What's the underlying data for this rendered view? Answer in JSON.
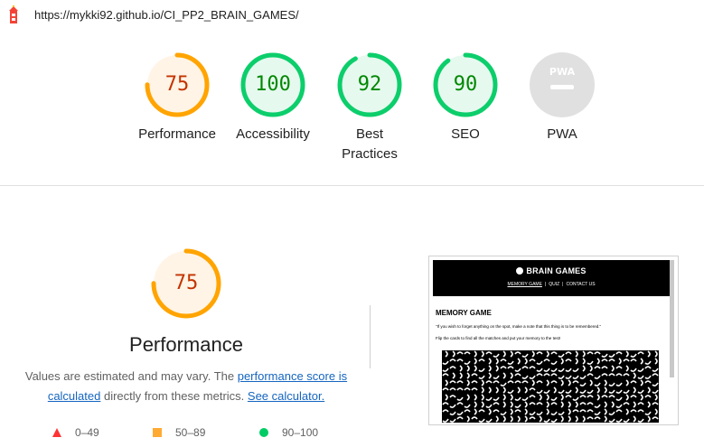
{
  "topbar": {
    "url": "https://mykki92.github.io/CI_PP2_BRAIN_GAMES/",
    "logo_icon": "lighthouse-icon"
  },
  "scores": [
    {
      "label": "Performance",
      "score": "75",
      "value": 75,
      "color": "#ffa400",
      "fill": "#fff4e6",
      "text": "#c33300"
    },
    {
      "label": "Accessibility",
      "score": "100",
      "value": 100,
      "color": "#0cce6b",
      "fill": "#e6f9ef",
      "text": "#008800"
    },
    {
      "label": "Best Practices",
      "score": "92",
      "value": 92,
      "color": "#0cce6b",
      "fill": "#e6f9ef",
      "text": "#008800"
    },
    {
      "label": "SEO",
      "score": "90",
      "value": 90,
      "color": "#0cce6b",
      "fill": "#e6f9ef",
      "text": "#008800"
    },
    {
      "label": "PWA",
      "score": "",
      "value": 0,
      "color": "#e0e0e0",
      "fill": "#e0e0e0",
      "text": "#ffffff",
      "badge": "PWA"
    }
  ],
  "performance": {
    "score": "75",
    "value": 75,
    "title": "Performance",
    "desc_prefix": "Values are estimated and may vary. The ",
    "link_score": "performance score is calculated",
    "desc_mid": " directly from these metrics. ",
    "link_calc": "See calculator."
  },
  "legend": [
    {
      "shape": "triangle",
      "label": "0–49",
      "color": "#ff3333"
    },
    {
      "shape": "square",
      "label": "50–89",
      "color": "#ffaa33"
    },
    {
      "shape": "circle",
      "label": "90–100",
      "color": "#00cc66"
    }
  ],
  "screenshot": {
    "brand": "BRAIN GAMES",
    "nav": [
      "MEMORY GAME",
      "QUIZ",
      "CONTACT US"
    ],
    "heading": "MEMORY GAME",
    "quote": "\"If you wish to forget anything on the spot, make a note that this thing is to be remembered.\"",
    "intro": "Flip the cards to find all the matches and put your memory to the test!"
  }
}
